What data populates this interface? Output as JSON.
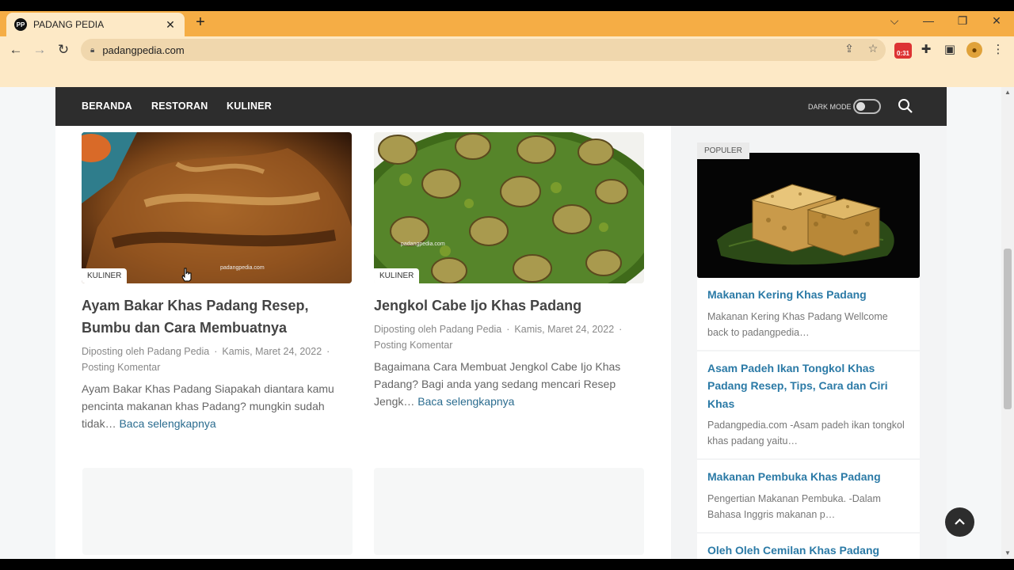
{
  "browser": {
    "tab_title": "PADANG PEDIA",
    "favicon_text": "PP",
    "url": "padangpedia.com",
    "ext_badge": "0:31"
  },
  "site_nav": {
    "links": [
      "BERANDA",
      "RESTORAN",
      "KULINER"
    ],
    "dark_mode_label": "DARK MODE"
  },
  "posts": [
    {
      "category": "KULINER",
      "title": "Ayam Bakar Khas Padang Resep, Bumbu dan Cara Membuatnya",
      "meta_author": "Diposting oleh Padang Pedia",
      "meta_date": "Kamis, Maret 24, 2022",
      "meta_comment": "Posting Komentar",
      "excerpt": "Ayam Bakar Khas Padang Siapakah diantara kamu pencinta makanan khas Padang? mungkin sudah tidak…",
      "read_more": "Baca selengkapnya",
      "image_watermark": "padangpedia.com"
    },
    {
      "category": "KULINER",
      "title": "Jengkol Cabe Ijo Khas Padang",
      "meta_author": "Diposting oleh Padang Pedia",
      "meta_date": "Kamis, Maret 24, 2022",
      "meta_comment": "Posting Komentar",
      "excerpt": "Bagaimana Cara Membuat Jengkol Cabe Ijo Khas Padang? Bagi anda yang sedang mencari Resep Jengk…",
      "read_more": "Baca selengkapnya",
      "image_watermark": "padangpedia.com"
    }
  ],
  "sidebar": {
    "label": "POPULER",
    "items": [
      {
        "title": "Makanan Kering Khas Padang",
        "excerpt": "Makanan Kering Khas Padang Wellcome back to padangpedia…"
      },
      {
        "title": "Asam Padeh Ikan Tongkol Khas Padang Resep, Tips, Cara dan Ciri Khas",
        "excerpt": "Padangpedia.com -Asam padeh ikan tongkol khas padang yaitu…"
      },
      {
        "title": "Makanan Pembuka Khas Padang",
        "excerpt": "Pengertian Makanan Pembuka. -Dalam Bahasa Inggris makanan p…"
      },
      {
        "title": "Oleh Oleh Cemilan Khas Padang Terbaik dan Populer",
        "excerpt": ""
      }
    ]
  },
  "colors": {
    "tab_strip": "#f5ad45",
    "toolbar": "#fde9c6",
    "nav_bg": "#2d2d2d",
    "link_blue": "#2b7aa6"
  }
}
